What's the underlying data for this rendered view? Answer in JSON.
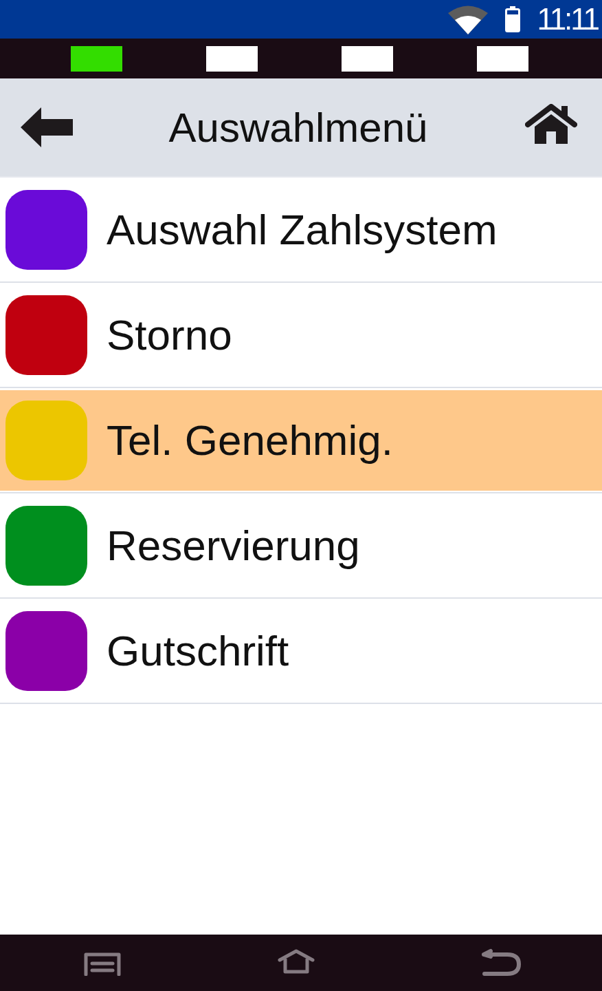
{
  "status_bar": {
    "time": "11:11"
  },
  "indicators": [
    {
      "color": "#33dd00"
    },
    {
      "color": "#ffffff"
    },
    {
      "color": "#ffffff"
    },
    {
      "color": "#ffffff"
    }
  ],
  "header": {
    "title": "Auswahlmenü"
  },
  "menu_items": [
    {
      "label": "Auswahl Zahlsystem",
      "color": "#6a0bd8",
      "selected": false
    },
    {
      "label": "Storno",
      "color": "#c0000f",
      "selected": false
    },
    {
      "label": "Tel. Genehmig.",
      "color": "#ecc600",
      "selected": true
    },
    {
      "label": "Reservierung",
      "color": "#008f1e",
      "selected": false
    },
    {
      "label": "Gutschrift",
      "color": "#8b00a8",
      "selected": false
    }
  ]
}
